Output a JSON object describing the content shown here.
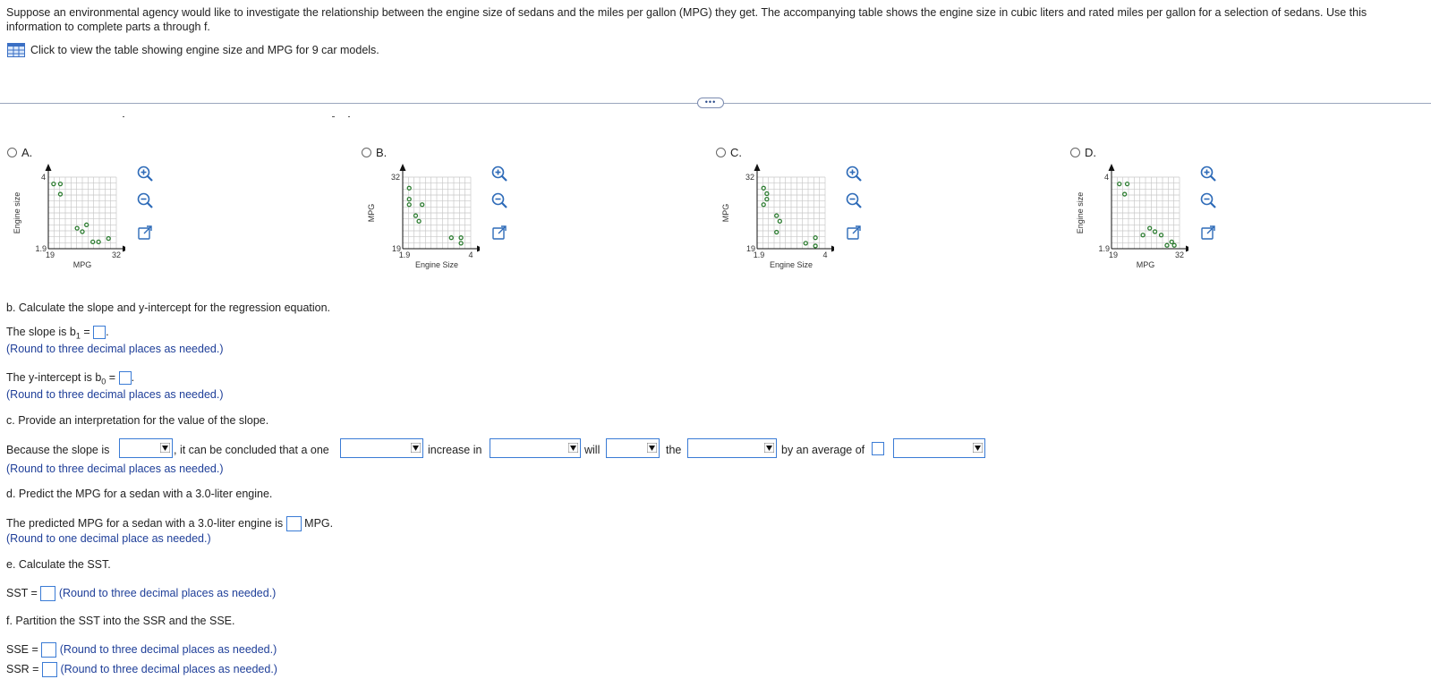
{
  "intro_text": "Suppose an environmental agency would like to investigate the relationship between the engine size of sedans and the miles per gallon (MPG) they get. The accompanying table shows the engine size in cubic liters and rated miles per gallon for a selection of sedans. Use this information to complete parts a through f.",
  "table_link": "Click to view the table showing engine size and MPG for 9 car models.",
  "dots": "•••",
  "options": [
    {
      "label": "A.",
      "xlabel": "MPG",
      "ylabel": "Engine size",
      "ytop": "4",
      "ybot": "1.9",
      "xleft": "19",
      "xright": "32"
    },
    {
      "label": "B.",
      "xlabel": "Engine Size",
      "ylabel": "MPG",
      "ytop": "32",
      "ybot": "19",
      "xleft": "1.9",
      "xright": "4"
    },
    {
      "label": "C.",
      "xlabel": "Engine Size",
      "ylabel": "MPG",
      "ytop": "32",
      "ybot": "19",
      "xleft": "1.9",
      "xright": "4"
    },
    {
      "label": "D.",
      "xlabel": "MPG",
      "ylabel": "Engine size",
      "ytop": "4",
      "ybot": "1.9",
      "xleft": "19",
      "xright": "32"
    }
  ],
  "chart_data": [
    {
      "type": "scatter",
      "title": "",
      "xlabel": "MPG",
      "ylabel": "Engine size",
      "xlim": [
        19,
        32
      ],
      "ylim": [
        1.9,
        4
      ],
      "points": [
        [
          20,
          3.8
        ],
        [
          21.3,
          3.8
        ],
        [
          21.3,
          3.5
        ],
        [
          24.5,
          2.5
        ],
        [
          25.5,
          2.4
        ],
        [
          26.3,
          2.6
        ],
        [
          27.5,
          2.1
        ],
        [
          28.6,
          2.1
        ],
        [
          30.5,
          2.2
        ]
      ]
    },
    {
      "type": "scatter",
      "title": "",
      "xlabel": "Engine Size",
      "ylabel": "MPG",
      "xlim": [
        1.9,
        4
      ],
      "ylim": [
        19,
        32
      ],
      "points": [
        [
          2.1,
          30
        ],
        [
          2.1,
          28
        ],
        [
          2.1,
          27
        ],
        [
          2.5,
          27
        ],
        [
          2.3,
          25
        ],
        [
          2.4,
          24
        ],
        [
          3.4,
          21
        ],
        [
          3.7,
          21
        ],
        [
          3.7,
          20
        ]
      ]
    },
    {
      "type": "scatter",
      "title": "",
      "xlabel": "Engine Size",
      "ylabel": "MPG",
      "xlim": [
        1.9,
        4
      ],
      "ylim": [
        19,
        32
      ],
      "points": [
        [
          2.1,
          30
        ],
        [
          2.2,
          29
        ],
        [
          2.2,
          28
        ],
        [
          2.1,
          27
        ],
        [
          2.5,
          25
        ],
        [
          2.6,
          24
        ],
        [
          2.5,
          22
        ],
        [
          3.4,
          20
        ],
        [
          3.7,
          21
        ],
        [
          3.7,
          19.5
        ]
      ]
    },
    {
      "type": "scatter",
      "title": "",
      "xlabel": "MPG",
      "ylabel": "Engine size",
      "xlim": [
        19,
        32
      ],
      "ylim": [
        1.9,
        4
      ],
      "points": [
        [
          20.5,
          3.8
        ],
        [
          22,
          3.8
        ],
        [
          21.5,
          3.5
        ],
        [
          26.3,
          2.5
        ],
        [
          27.3,
          2.4
        ],
        [
          25,
          2.3
        ],
        [
          28.5,
          2.3
        ],
        [
          29.6,
          2.0
        ],
        [
          30.5,
          2.1
        ],
        [
          31,
          2.0
        ]
      ]
    }
  ],
  "part_b": {
    "heading": "b. Calculate the slope and y-intercept for the regression equation.",
    "slope_text": "The slope is b",
    "slope_sub": "1",
    "slope_eq": " =",
    "round3": "(Round to three decimal places as needed.)",
    "intercept_text": "The y-intercept is b",
    "intercept_sub": "0",
    "intercept_eq": " ="
  },
  "part_c": {
    "heading": "c. Provide an interpretation for the value of the slope.",
    "because": "Because the slope is",
    "conclude": ", it can be concluded that a one",
    "increase_in": "increase in",
    "will": "will",
    "the": "the",
    "by_avg": "by an average of",
    "round3": "(Round to three decimal places as needed.)"
  },
  "part_d": {
    "heading": "d. Predict the MPG for a sedan with a 3.0-liter engine.",
    "text": "The predicted MPG for a sedan with a 3.0-liter engine is",
    "unit": "MPG.",
    "round1": "(Round to one decimal place as needed.)"
  },
  "part_e": {
    "heading": "e. Calculate the SST.",
    "label": "SST =",
    "round3": "(Round to three decimal places as needed.)"
  },
  "part_f": {
    "heading": "f. Partition the SST into the SSR and the SSE.",
    "sse_label": "SSE =",
    "ssr_label": "SSR =",
    "round3": "(Round to three decimal places as needed.)"
  }
}
